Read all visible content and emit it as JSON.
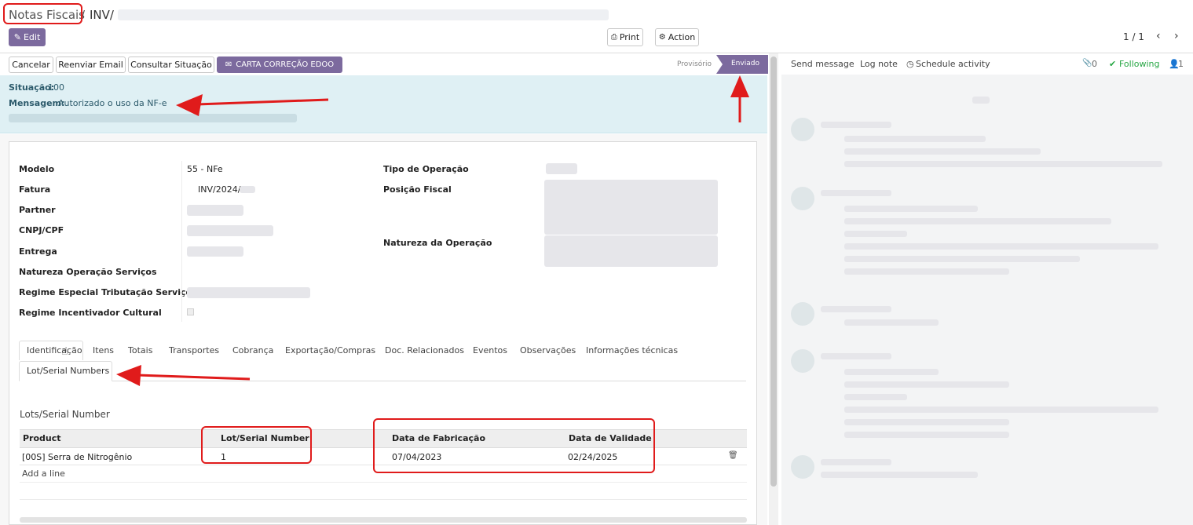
{
  "breadcrumb": {
    "root": "Notas Fiscais",
    "separator": "/",
    "record": "INV/"
  },
  "control": {
    "edit": "Edit",
    "print": "Print",
    "action": "Action",
    "pager": "1 / 1"
  },
  "statusbar": {
    "buttons": [
      "Cancelar",
      "Reenviar Email",
      "Consultar Situação"
    ],
    "primary": "CARTA CORREÇÃO EDOO",
    "stages": {
      "draft": "Provisório",
      "sent": "Enviado"
    }
  },
  "alert": {
    "situacao_label": "Situação:",
    "situacao_value": "100",
    "mensagem_label": "Mensagem:",
    "mensagem_value": "Autorizado o uso da NF-e"
  },
  "form": {
    "left": [
      {
        "label": "Modelo",
        "value": "55 - NFe"
      },
      {
        "label": "Fatura",
        "value": "INV/2024/"
      },
      {
        "label": "Partner",
        "value": ""
      },
      {
        "label": "CNPJ/CPF",
        "value": ""
      },
      {
        "label": "Entrega",
        "value": ""
      },
      {
        "label": "Natureza Operação Serviços",
        "value": ""
      },
      {
        "label": "Regime Especial Tributação Serviço",
        "value": ""
      },
      {
        "label": "Regime Incentivador Cultural",
        "value": ""
      }
    ],
    "right": [
      {
        "label": "Tipo de Operação"
      },
      {
        "label": "Posição Fiscal"
      },
      {
        "label": "Natureza da Operação"
      }
    ]
  },
  "tabs": [
    "Identificação",
    "Itens",
    "Totais",
    "Transportes",
    "Cobrança",
    "Exportação/Compras",
    "Doc. Relacionados",
    "Eventos",
    "Observações",
    "Informações técnicas"
  ],
  "active_tab": "Lot/Serial Numbers",
  "lots": {
    "title": "Lots/Serial Number",
    "headers": [
      "Product",
      "Lot/Serial Number",
      "Data de Fabricação",
      "Data de Validade"
    ],
    "rows": [
      {
        "product": "[00S] Serra de Nitrogênio",
        "lot": "1",
        "fab": "07/04/2023",
        "val": "02/24/2025"
      }
    ],
    "add_line": "Add a line"
  },
  "chatter": {
    "send": "Send message",
    "log": "Log note",
    "schedule": "Schedule activity",
    "attachments": "0",
    "following": "Following",
    "followers": "1"
  },
  "colors": {
    "primary": "#7c6a9e",
    "alert_bg": "#dff0f4",
    "annotation": "#e01b1b",
    "following": "#28a745"
  }
}
